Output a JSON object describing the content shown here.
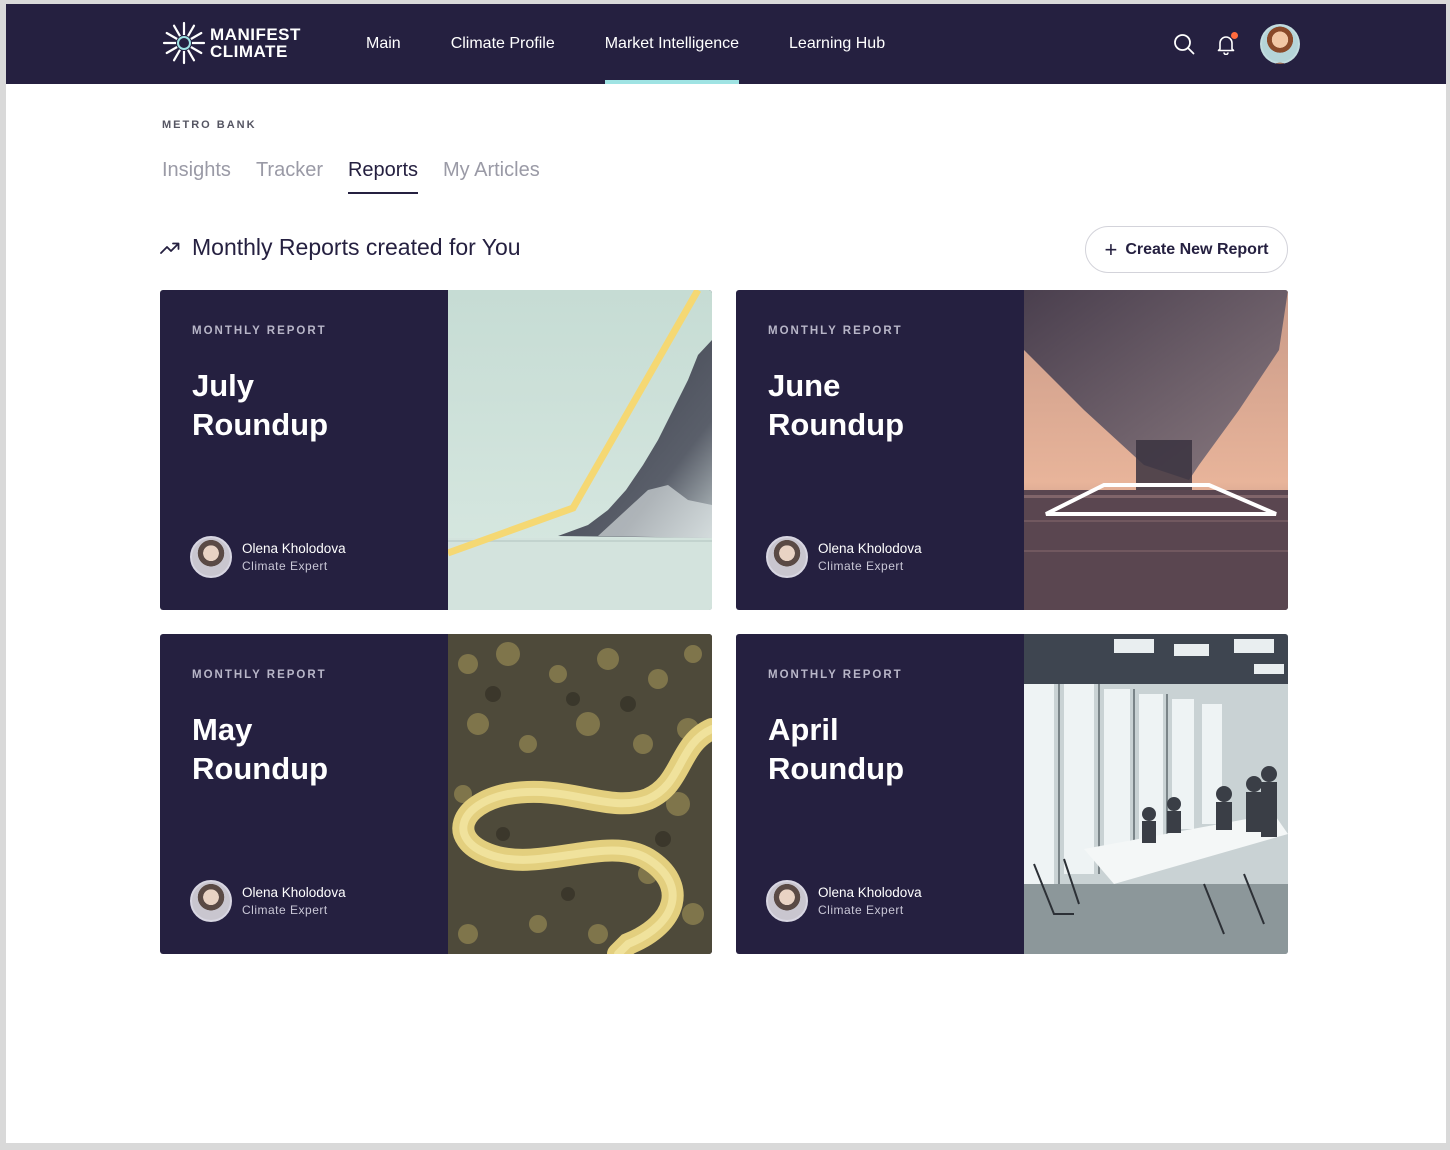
{
  "brand": {
    "line1": "MANIFEST",
    "line2": "CLIMATE"
  },
  "nav": {
    "items": [
      {
        "label": "Main",
        "active": false
      },
      {
        "label": "Climate Profile",
        "active": false
      },
      {
        "label": "Market Intelligence",
        "active": true
      },
      {
        "label": "Learning Hub",
        "active": false
      }
    ],
    "icons": [
      "search-icon",
      "bell-icon",
      "avatar"
    ]
  },
  "breadcrumb": "METRO BANK",
  "tabs": [
    {
      "label": "Insights",
      "active": false
    },
    {
      "label": "Tracker",
      "active": false
    },
    {
      "label": "Reports",
      "active": true
    },
    {
      "label": "My Articles",
      "active": false
    }
  ],
  "section": {
    "title": "Monthly Reports created for You",
    "icon": "trend-up-icon",
    "create_button": "Create New Report"
  },
  "cards": [
    {
      "label": "MONTHLY REPORT",
      "title_line1": "July",
      "title_line2": "Roundup",
      "author": "Olena Kholodova",
      "role": "Climate Expert",
      "image": "mountain-lake"
    },
    {
      "label": "MONTHLY REPORT",
      "title_line1": "June",
      "title_line2": "Roundup",
      "author": "Olena Kholodova",
      "role": "Climate Expert",
      "image": "ship-bow-water"
    },
    {
      "label": "MONTHLY REPORT",
      "title_line1": "May",
      "title_line2": "Roundup",
      "author": "Olena Kholodova",
      "role": "Climate Expert",
      "image": "forest-road"
    },
    {
      "label": "MONTHLY REPORT",
      "title_line1": "April",
      "title_line2": "Roundup",
      "author": "Olena Kholodova",
      "role": "Climate Expert",
      "image": "office-meeting"
    }
  ],
  "colors": {
    "navy": "#252040",
    "accent": "#9fe3e3",
    "notification": "#ff6b3d"
  }
}
